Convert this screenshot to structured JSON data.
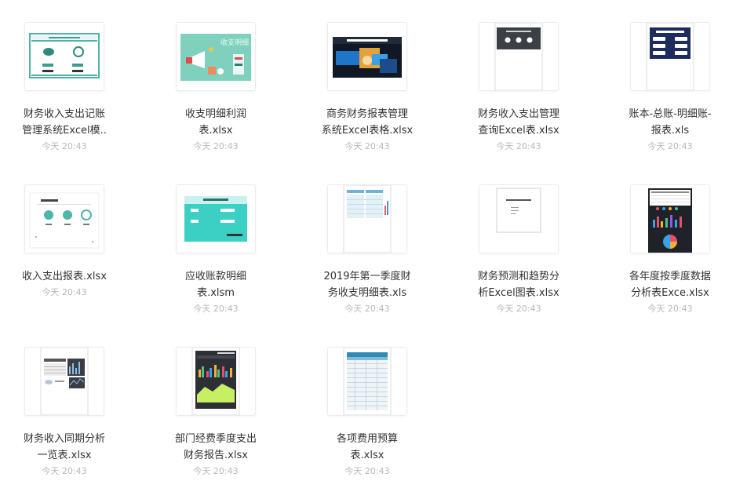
{
  "colors": {
    "name": "#333333",
    "time": "#b8b8b8",
    "border": "#ececec"
  },
  "files": [
    {
      "name_lines": [
        "财务收入支出记账",
        "管理系统Excel模.."
      ],
      "time": "今天 20:43",
      "thumb": "teal-form-icon"
    },
    {
      "name_lines": [
        "收支明细利润",
        "表.xlsx"
      ],
      "time": "今天 20:43",
      "thumb": "teal-illustration-icon"
    },
    {
      "name_lines": [
        "商务财务报表管理",
        "系统Excel表格.xlsx"
      ],
      "time": "今天 20:43",
      "thumb": "dark-business-photo-icon"
    },
    {
      "name_lines": [
        "财务收入支出管理",
        "查询Excel表.xlsx"
      ],
      "time": "今天 20:43",
      "thumb": "dark-header-document-icon"
    },
    {
      "name_lines": [
        "账本-总账-明细账-",
        "报表.xls"
      ],
      "time": "今天 20:43",
      "thumb": "navy-menu-document-icon"
    },
    {
      "name_lines": [
        "收入支出报表.xlsx"
      ],
      "time": "今天 20:43",
      "thumb": "white-dashboard-icon"
    },
    {
      "name_lines": [
        "应收账款明细",
        "表.xlsm"
      ],
      "time": "今天 20:43",
      "thumb": "turquoise-form-icon"
    },
    {
      "name_lines": [
        "2019年第一季度财",
        "务收支明细表.xls"
      ],
      "time": "今天 20:43",
      "thumb": "spreadsheet-chart-icon"
    },
    {
      "name_lines": [
        "财务预测和趋势分",
        "析Excel图表.xlsx"
      ],
      "time": "今天 20:43",
      "thumb": "blank-document-icon"
    },
    {
      "name_lines": [
        "各年度按季度数据",
        "分析表Exce.xlsx"
      ],
      "time": "今天 20:43",
      "thumb": "dark-chart-dashboard-icon"
    },
    {
      "name_lines": [
        "财务收入同期分析",
        "一览表.xlsx"
      ],
      "time": "今天 20:43",
      "thumb": "table-line-chart-icon"
    },
    {
      "name_lines": [
        "部门经费季度支出",
        "财务报告.xlsx"
      ],
      "time": "今天 20:43",
      "thumb": "dark-bar-chart-document-icon"
    },
    {
      "name_lines": [
        "各项费用预算",
        "表.xlsx"
      ],
      "time": "今天 20:43",
      "thumb": "blue-spreadsheet-document-icon"
    }
  ]
}
